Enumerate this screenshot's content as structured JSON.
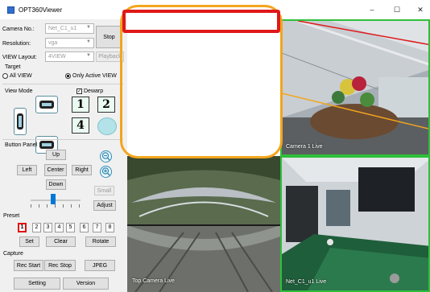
{
  "window": {
    "title": "OPT360Viewer",
    "controls": {
      "minimize": "–",
      "maximize": "☐",
      "close": "✕"
    }
  },
  "panel": {
    "camera_label": "Camera No.:",
    "camera_value": "Net_C1_u1",
    "resolution_label": "Resolution:",
    "resolution_value": "vga",
    "view_layout_label": "VIEW Layout:",
    "view_layout_value": "4VIEW",
    "stop_label": "Stop",
    "playback_label": "Playback",
    "target_label": "Target",
    "all_view_label": "All VIEW",
    "only_active_label": "Only Active VIEW",
    "view_mode_label": "View Mode",
    "dewarp_label": "Dewarp",
    "layout_buttons": [
      "1",
      "2",
      "4"
    ],
    "button_panel_label": "Button Panel",
    "up_label": "Up",
    "left_label": "Left",
    "center_label": "Center",
    "right_label": "Right",
    "down_label": "Down",
    "small_label": "Small",
    "adjust_label": "Adjust",
    "slider_value": 0.45,
    "preset_label": "Preset",
    "presets": [
      "1",
      "2",
      "3",
      "4",
      "5",
      "6",
      "7",
      "8"
    ],
    "set_label": "Set",
    "clear_label": "Clear",
    "rotate_label": "Rotate",
    "capture_label": "Capture",
    "rec_start_label": "Rec Start",
    "rec_stop_label": "Rec Stop",
    "jpeg_label": "JPEG",
    "setting_label": "Setting",
    "version_label": "Version"
  },
  "views": {
    "top_right_caption": "Camera 1 Live",
    "bottom_left_caption": "Top Camera Live",
    "bottom_right_caption": "Net_C1_u1 Live"
  },
  "colors": {
    "active_border": "#2fbf3a",
    "highlight_orange": "#f3a51d",
    "highlight_red": "#e01818",
    "dewarp_blue": "#2e8bb5"
  }
}
